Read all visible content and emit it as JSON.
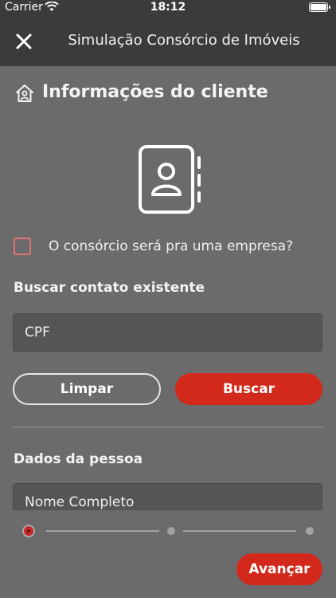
{
  "status_bar": {
    "carrier": "Carrier",
    "time": "18:12"
  },
  "nav": {
    "title": "Simulação Consórcio de Imóveis",
    "close_icon": "close-icon"
  },
  "section": {
    "title": "Informações do cliente",
    "icon": "house-person-icon"
  },
  "contact_icon": "address-book-icon",
  "company_checkbox": {
    "label": "O consórcio será pra uma empresa?",
    "checked": false,
    "border_color": "#e57373"
  },
  "search": {
    "heading": "Buscar contato existente",
    "cpf_placeholder": "CPF",
    "clear_label": "Limpar",
    "search_label": "Buscar"
  },
  "person": {
    "heading": "Dados da pessoa",
    "name_placeholder": "Nome Completo"
  },
  "stepper": {
    "current_step": 1,
    "total_steps": 3
  },
  "footer": {
    "next_label": "Avançar"
  },
  "colors": {
    "accent": "#d3291c",
    "background": "#6b6b6b",
    "header": "#3b3b3b"
  }
}
